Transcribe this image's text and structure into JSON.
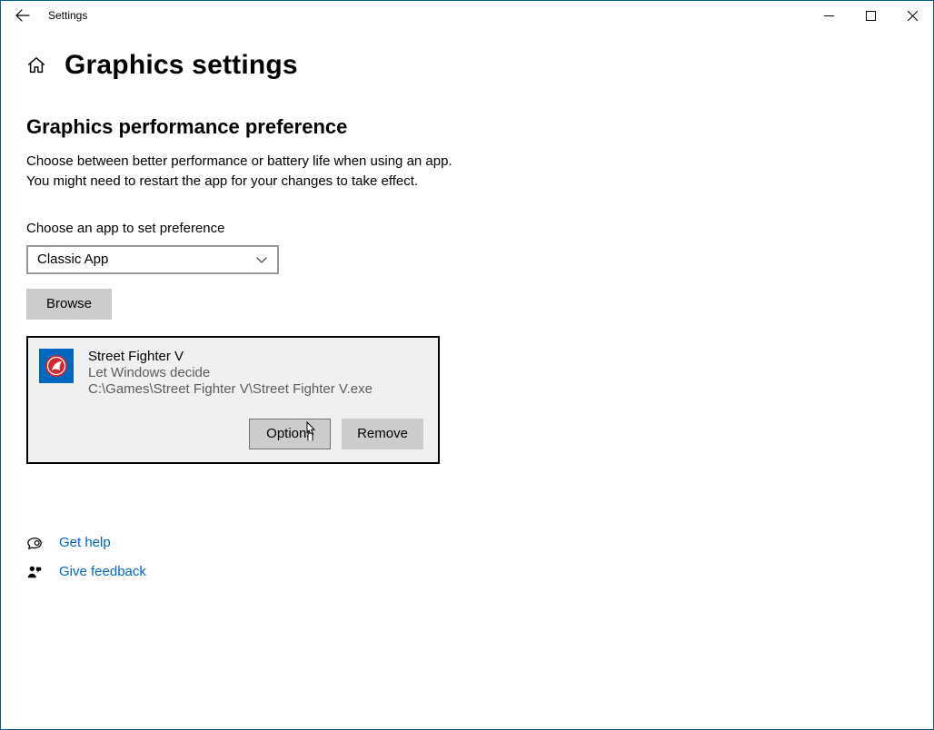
{
  "window": {
    "appTitle": "Settings"
  },
  "page": {
    "title": "Graphics settings",
    "sectionHeading": "Graphics performance preference",
    "descLine1": "Choose between better performance or battery life when using an app.",
    "descLine2": "You might need to restart the app for your changes to take effect.",
    "chooseAppLabel": "Choose an app to set preference",
    "appTypeSelected": "Classic App",
    "browseLabel": "Browse"
  },
  "appCard": {
    "name": "Street Fighter V",
    "preference": "Let Windows decide",
    "path": "C:\\Games\\Street Fighter V\\Street Fighter V.exe",
    "optionsLabel": "Options",
    "removeLabel": "Remove"
  },
  "links": {
    "help": "Get help",
    "feedback": "Give feedback"
  }
}
